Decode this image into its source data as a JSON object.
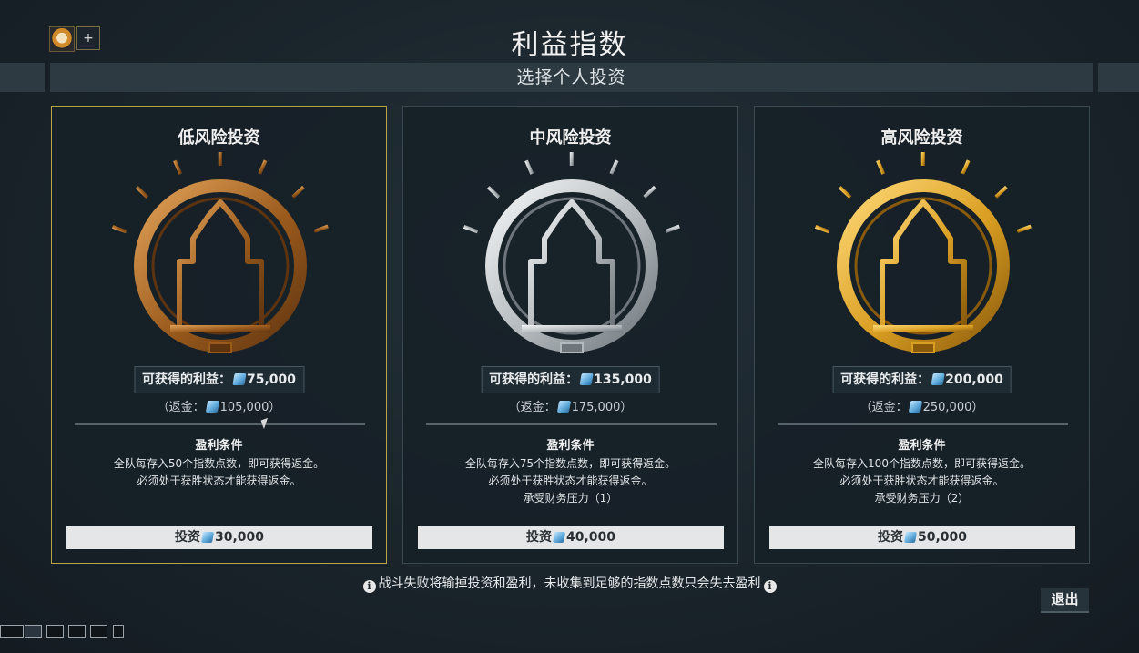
{
  "window": {
    "title": "利益指数",
    "subtitle": "选择个人投资",
    "plus_label": "+"
  },
  "cards": [
    {
      "title": "低风险投资",
      "tier": "bronze",
      "reward_label": "可获得的利益：",
      "reward_value": "75,000",
      "refund_prefix": "（返金：",
      "refund_value": "105,000",
      "refund_suffix": "）",
      "condition_title": "盈利条件",
      "condition_lines": [
        "全队每存入50个指数点数，即可获得返金。",
        "必须处于获胜状态才能获得返金。"
      ],
      "button_label": "投资",
      "button_value": "30,000",
      "selected": true
    },
    {
      "title": "中风险投资",
      "tier": "silver",
      "reward_label": "可获得的利益：",
      "reward_value": "135,000",
      "refund_prefix": "（返金：",
      "refund_value": "175,000",
      "refund_suffix": "）",
      "condition_title": "盈利条件",
      "condition_lines": [
        "全队每存入75个指数点数，即可获得返金。",
        "必须处于获胜状态才能获得返金。",
        "承受财务压力（1）"
      ],
      "button_label": "投资",
      "button_value": "40,000",
      "selected": false
    },
    {
      "title": "高风险投资",
      "tier": "gold",
      "reward_label": "可获得的利益：",
      "reward_value": "200,000",
      "refund_prefix": "（返金：",
      "refund_value": "250,000",
      "refund_suffix": "）",
      "condition_title": "盈利条件",
      "condition_lines": [
        "全队每存入100个指数点数，即可获得返金。",
        "必须处于获胜状态才能获得返金。",
        "承受财务压力（2）"
      ],
      "button_label": "投资",
      "button_value": "50,000",
      "selected": false
    }
  ],
  "footer": {
    "note": "战斗失败将输掉投资和盈利，未收集到足够的指数点数只会失去盈利",
    "info_glyph": "i"
  },
  "exit_label": "退出",
  "colors": {
    "bronze": "#b4702a",
    "silver": "#c9cdcf",
    "gold": "#d9a024",
    "selected_border": "#b7a54a"
  },
  "icons": [
    "player-avatar-icon",
    "info-icon",
    "currency-icon",
    "emblem-icon"
  ]
}
